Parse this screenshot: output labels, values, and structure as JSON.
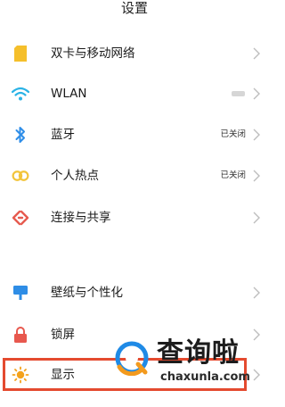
{
  "header": {
    "title": "设置"
  },
  "settings": {
    "items": [
      {
        "label": "双卡与移动网络",
        "status": "",
        "icon": "sim-card-icon"
      },
      {
        "label": "WLAN",
        "status": "",
        "icon": "wifi-icon"
      },
      {
        "label": "蓝牙",
        "status": "已关闭",
        "icon": "bluetooth-icon"
      },
      {
        "label": "个人热点",
        "status": "已关闭",
        "icon": "hotspot-icon"
      },
      {
        "label": "连接与共享",
        "status": "",
        "icon": "share-icon"
      },
      {
        "label": "壁纸与个性化",
        "status": "",
        "icon": "wallpaper-icon"
      },
      {
        "label": "锁屏",
        "status": "",
        "icon": "lock-icon"
      },
      {
        "label": "显示",
        "status": "",
        "icon": "sun-icon"
      }
    ]
  },
  "watermark": {
    "text": "查询啦",
    "url_text": "chaxunla.com"
  },
  "colors": {
    "sim": "#f5bf2b",
    "wifi": "#2bb3e6",
    "bluetooth": "#2f8ee8",
    "hotspot": "#f2c43a",
    "share": "#e65a4f",
    "wallpaper": "#2e8de6",
    "lock": "#e8584e",
    "sun": "#f4a21c",
    "highlight": "#e44a2f",
    "watermark_accent": "#1f8ae6",
    "watermark_orange": "#f39a1e"
  }
}
